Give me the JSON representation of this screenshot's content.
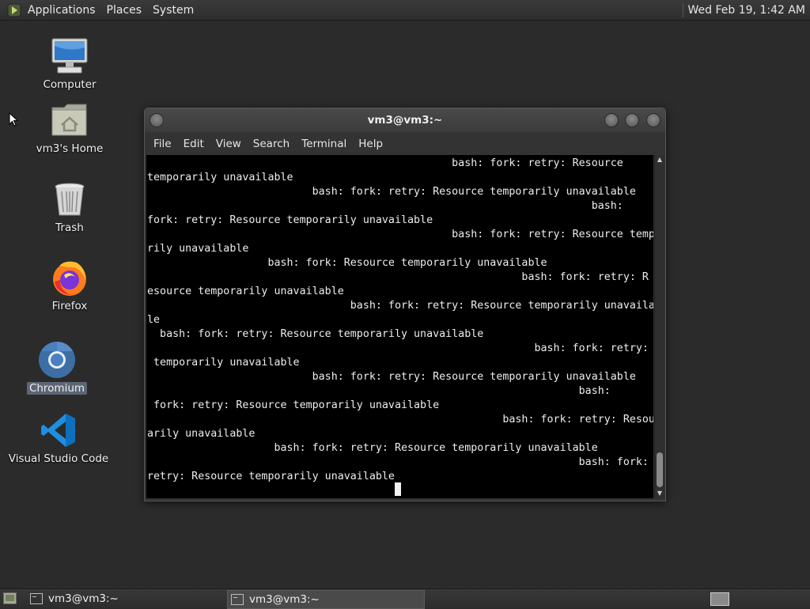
{
  "top_panel": {
    "menus": [
      "Applications",
      "Places",
      "System"
    ],
    "clock": "Wed Feb 19,  1:42 AM"
  },
  "desktop_icons": [
    {
      "label": "Computer",
      "icon": "computer-icon"
    },
    {
      "label": "vm3's Home",
      "icon": "home-folder-icon"
    },
    {
      "label": "Trash",
      "icon": "trash-icon"
    },
    {
      "label": "Firefox",
      "icon": "firefox-icon"
    },
    {
      "label": "Chromium",
      "icon": "chromium-icon",
      "selected": true
    },
    {
      "label": "Visual Studio Code",
      "icon": "vscode-icon"
    }
  ],
  "terminal": {
    "title": "vm3@vm3:~",
    "menus": [
      "File",
      "Edit",
      "View",
      "Search",
      "Terminal",
      "Help"
    ],
    "output": "                                                bash: fork: retry: Resource \ntemporarily unavailable\n                          bash: fork: retry: Resource temporarily unavailable\n                                                                      bash: \nfork: retry: Resource temporarily unavailable\n                                                bash: fork: retry: Resource tempora\nrily unavailable\n                   bash: fork: Resource temporarily unavailable\n                                                           bash: fork: retry: R\nesource temporarily unavailable\n                                bash: fork: retry: Resource temporarily unavailab\nle\n  bash: fork: retry: Resource temporarily unavailable\n                                                             bash: fork: retry: Resource \n temporarily unavailable\n                          bash: fork: retry: Resource temporarily unavailable\n                                                                    bash: \n fork: retry: Resource temporarily unavailable\n                                                        bash: fork: retry: Resource tempor\narily unavailable\n                    bash: fork: retry: Resource temporarily unavailable\n                                                                    bash: fork: \nretry: Resource temporarily unavailable"
  },
  "taskbar": {
    "tasks": [
      {
        "label": "vm3@vm3:~",
        "active": false
      },
      {
        "label": "vm3@vm3:~",
        "active": true
      }
    ]
  },
  "colors": {
    "desktop_bg": "#2b2b2b",
    "terminal_bg": "#000000",
    "terminal_fg": "#ededed",
    "selection_bg": "#5c6675"
  }
}
